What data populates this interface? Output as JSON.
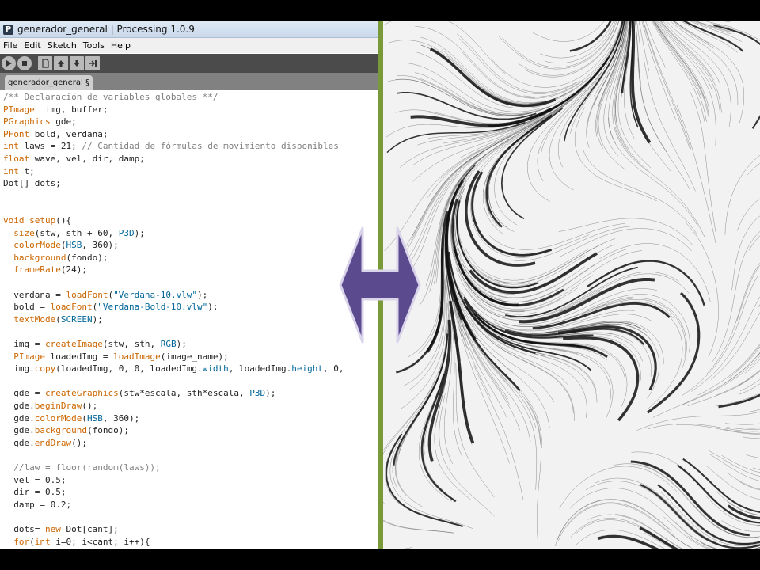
{
  "window": {
    "title": "generador_general | Processing 1.0.9",
    "app_icon_letter": "P"
  },
  "menu": [
    "File",
    "Edit",
    "Sketch",
    "Tools",
    "Help"
  ],
  "toolbar": {
    "buttons": [
      "run-icon",
      "stop-icon",
      "new-icon",
      "open-icon",
      "save-icon",
      "export-icon"
    ]
  },
  "tab": {
    "label": "generador_general §"
  },
  "code_lines": [
    [
      [
        "cm",
        "/** Declaración de variables globales **/"
      ]
    ],
    [
      [
        "ty",
        "PImage"
      ],
      [
        "",
        "  img, buffer;"
      ]
    ],
    [
      [
        "ty",
        "PGraphics"
      ],
      [
        "",
        " gde;"
      ]
    ],
    [
      [
        "ty",
        "PFont"
      ],
      [
        "",
        " bold, verdana;"
      ]
    ],
    [
      [
        "kw",
        "int"
      ],
      [
        "",
        " laws = 21; "
      ],
      [
        "cm",
        "// Cantidad de fórmulas de movimiento disponibles"
      ]
    ],
    [
      [
        "kw",
        "float"
      ],
      [
        "",
        " wave, vel, dir, damp;"
      ]
    ],
    [
      [
        "kw",
        "int"
      ],
      [
        "",
        " t;"
      ]
    ],
    [
      [
        "",
        "Dot[] dots;"
      ]
    ],
    [
      [
        "",
        ""
      ]
    ],
    [
      [
        "",
        ""
      ]
    ],
    [
      [
        "kw",
        "void"
      ],
      [
        "",
        " "
      ],
      [
        "fn",
        "setup"
      ],
      [
        "",
        "(){"
      ]
    ],
    [
      [
        "",
        "  "
      ],
      [
        "fn",
        "size"
      ],
      [
        "",
        "(stw, sth + 60, "
      ],
      [
        "cn",
        "P3D"
      ],
      [
        "",
        ");"
      ]
    ],
    [
      [
        "",
        "  "
      ],
      [
        "fn",
        "colorMode"
      ],
      [
        "",
        "("
      ],
      [
        "cn",
        "HSB"
      ],
      [
        "",
        ", 360);"
      ]
    ],
    [
      [
        "",
        "  "
      ],
      [
        "fn",
        "background"
      ],
      [
        "",
        "(fondo);"
      ]
    ],
    [
      [
        "",
        "  "
      ],
      [
        "fn",
        "frameRate"
      ],
      [
        "",
        "(24);"
      ]
    ],
    [
      [
        "",
        ""
      ]
    ],
    [
      [
        "",
        "  verdana = "
      ],
      [
        "fn",
        "loadFont"
      ],
      [
        "",
        "("
      ],
      [
        "st",
        "\"Verdana-10.vlw\""
      ],
      [
        "",
        ");"
      ]
    ],
    [
      [
        "",
        "  bold = "
      ],
      [
        "fn",
        "loadFont"
      ],
      [
        "",
        "("
      ],
      [
        "st",
        "\"Verdana-Bold-10.vlw\""
      ],
      [
        "",
        ");"
      ]
    ],
    [
      [
        "",
        "  "
      ],
      [
        "fn",
        "textMode"
      ],
      [
        "",
        "("
      ],
      [
        "cn",
        "SCREEN"
      ],
      [
        "",
        ");"
      ]
    ],
    [
      [
        "",
        ""
      ]
    ],
    [
      [
        "",
        "  img = "
      ],
      [
        "fn",
        "createImage"
      ],
      [
        "",
        "(stw, sth, "
      ],
      [
        "cn",
        "RGB"
      ],
      [
        "",
        ");"
      ]
    ],
    [
      [
        "",
        "  "
      ],
      [
        "ty",
        "PImage"
      ],
      [
        "",
        " loadedImg = "
      ],
      [
        "fn",
        "loadImage"
      ],
      [
        "",
        "(image_name);"
      ]
    ],
    [
      [
        "",
        "  img."
      ],
      [
        "fn",
        "copy"
      ],
      [
        "",
        "(loadedImg, 0, 0, loadedImg."
      ],
      [
        "cn",
        "width"
      ],
      [
        "",
        ", loadedImg."
      ],
      [
        "cn",
        "height"
      ],
      [
        "",
        ", 0,"
      ]
    ],
    [
      [
        "",
        ""
      ]
    ],
    [
      [
        "",
        "  gde = "
      ],
      [
        "fn",
        "createGraphics"
      ],
      [
        "",
        "(stw*escala, sth*escala, "
      ],
      [
        "cn",
        "P3D"
      ],
      [
        "",
        ");"
      ]
    ],
    [
      [
        "",
        "  gde."
      ],
      [
        "fn",
        "beginDraw"
      ],
      [
        "",
        "();"
      ]
    ],
    [
      [
        "",
        "  gde."
      ],
      [
        "fn",
        "colorMode"
      ],
      [
        "",
        "("
      ],
      [
        "cn",
        "HSB"
      ],
      [
        "",
        ", 360);"
      ]
    ],
    [
      [
        "",
        "  gde."
      ],
      [
        "fn",
        "background"
      ],
      [
        "",
        "(fondo);"
      ]
    ],
    [
      [
        "",
        "  gde."
      ],
      [
        "fn",
        "endDraw"
      ],
      [
        "",
        "();"
      ]
    ],
    [
      [
        "",
        ""
      ]
    ],
    [
      [
        "",
        "  "
      ],
      [
        "cm",
        "//law = floor(random(laws));"
      ]
    ],
    [
      [
        "",
        "  vel = 0.5;"
      ]
    ],
    [
      [
        "",
        "  dir = 0.5;"
      ]
    ],
    [
      [
        "",
        "  damp = 0.2;"
      ]
    ],
    [
      [
        "",
        ""
      ]
    ],
    [
      [
        "",
        "  dots= "
      ],
      [
        "kw",
        "new"
      ],
      [
        "",
        " Dot[cant];"
      ]
    ],
    [
      [
        "",
        "  "
      ],
      [
        "kw",
        "for"
      ],
      [
        "",
        "("
      ],
      [
        "kw",
        "int"
      ],
      [
        "",
        " i=0; i<cant; i++){"
      ]
    ]
  ],
  "colors": {
    "divider": "#7a9a3a",
    "arrow_fill": "#5b4a8e",
    "arrow_stroke": "#d9d4ea",
    "toolbar_bg": "#4b4b4b",
    "tabs_bg": "#818181"
  },
  "artwork": {
    "description_icon": "flow-field-artwork-image"
  }
}
